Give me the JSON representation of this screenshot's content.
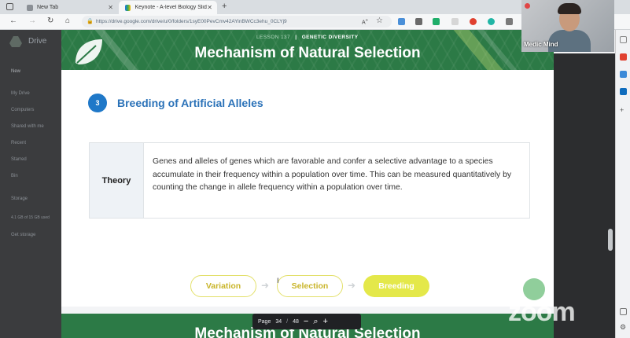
{
  "browser": {
    "tabs": [
      {
        "label": "New Tab",
        "active": false
      },
      {
        "label": "Keynote - A-level Biology Slides",
        "active": true
      }
    ],
    "new_tab_symbol": "+",
    "url": "https://drive.google.com/drive/u/0/folders/1syE00PevCmv42AYinBWCc3ehu_0CLYj9"
  },
  "drive": {
    "title": "Drive",
    "new_label": "New",
    "nav_items": [
      "My Drive",
      "Computers",
      "Shared with me",
      "Recent",
      "Starred",
      "Bin",
      "Storage",
      "4.1 GB of 15 GB used",
      "Get storage"
    ]
  },
  "slide": {
    "lesson_label": "LESSON 137",
    "lesson_topic": "GENETIC DIVERSITY",
    "title": "Mechanism of Natural Selection",
    "section_number": "3",
    "section_title": "Breeding of Artificial Alleles",
    "theory_label": "Theory",
    "theory_text": "Genes and alleles of genes which are favorable and confer a selective advantage to a species accumulate in their frequency within a population over time. This can be measured quantitatively by counting the change in allele frequency within a population over time.",
    "steps": [
      {
        "label": "Variation",
        "state": "outline"
      },
      {
        "label": "Selection",
        "state": "outline"
      },
      {
        "label": "Breeding",
        "state": "filled"
      }
    ],
    "next_slide_title": "Mechanism of Natural Selection"
  },
  "pager": {
    "page_label": "Page",
    "current_page": "34",
    "separator": "/",
    "total_pages": "48",
    "zoom_out": "−",
    "zoom_in": "+"
  },
  "video": {
    "participant_name": "Medic Mind",
    "watermark": "zoom"
  },
  "colors": {
    "banner_green": "#2c7a46",
    "section_blue": "#2b72b8",
    "badge_blue": "#1f78c8",
    "pill_yellow": "#e4e84a"
  }
}
